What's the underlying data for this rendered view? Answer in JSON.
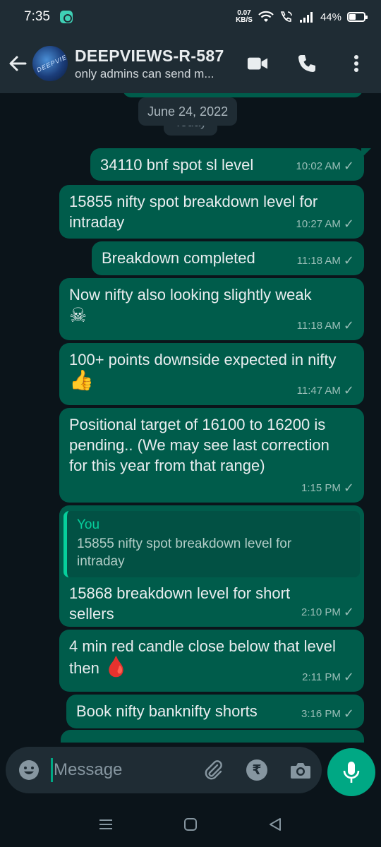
{
  "status_bar": {
    "time": "7:35",
    "net_speed_value": "0.07",
    "net_speed_unit": "KB/S",
    "battery": "44%"
  },
  "header": {
    "title": "DEEPVIEWS-R-587",
    "subtitle": "only admins can send m...",
    "avatar_text": "DEEPVIEW"
  },
  "chat": {
    "date_chip": "June 24, 2022",
    "today_label": "Today",
    "messages": [
      {
        "text": "34110 bnf spot sl level",
        "time": "10:02 AM"
      },
      {
        "text": "15855 nifty spot breakdown level for intraday",
        "time": "10:27 AM"
      },
      {
        "text": "Breakdown completed",
        "time": "11:18 AM"
      },
      {
        "text": "Now nifty also looking slightly weak",
        "emoji": "☠",
        "time": "11:18 AM"
      },
      {
        "text": "100+ points downside expected in nifty",
        "emoji": "👍",
        "time": "11:47 AM"
      },
      {
        "text": "Positional target of 16100 to 16200 is pending.. (We may see last correction for this year from that range)",
        "time": "1:15 PM"
      },
      {
        "quote_author": "You",
        "quote_text": "15855 nifty spot breakdown level for intraday",
        "text": "15868 breakdown level for short sellers",
        "time": "2:10 PM"
      },
      {
        "text": "4 min red candle close below that level then",
        "emoji": "🩸",
        "time": "2:11 PM"
      },
      {
        "text": "Book nifty banknifty shorts",
        "time": "3:16 PM"
      }
    ]
  },
  "input": {
    "placeholder": "Message"
  },
  "colors": {
    "outgoing_bubble": "#005c4b",
    "background": "#0b141a",
    "header": "#1f2c34",
    "accent": "#00a884"
  },
  "icons": {
    "back": "back-arrow-icon",
    "video": "video-call-icon",
    "call": "phone-icon",
    "menu": "more-vert-icon",
    "emoji": "emoji-icon",
    "attach": "paperclip-icon",
    "payment": "rupee-icon",
    "camera": "camera-icon",
    "mic": "mic-icon"
  }
}
